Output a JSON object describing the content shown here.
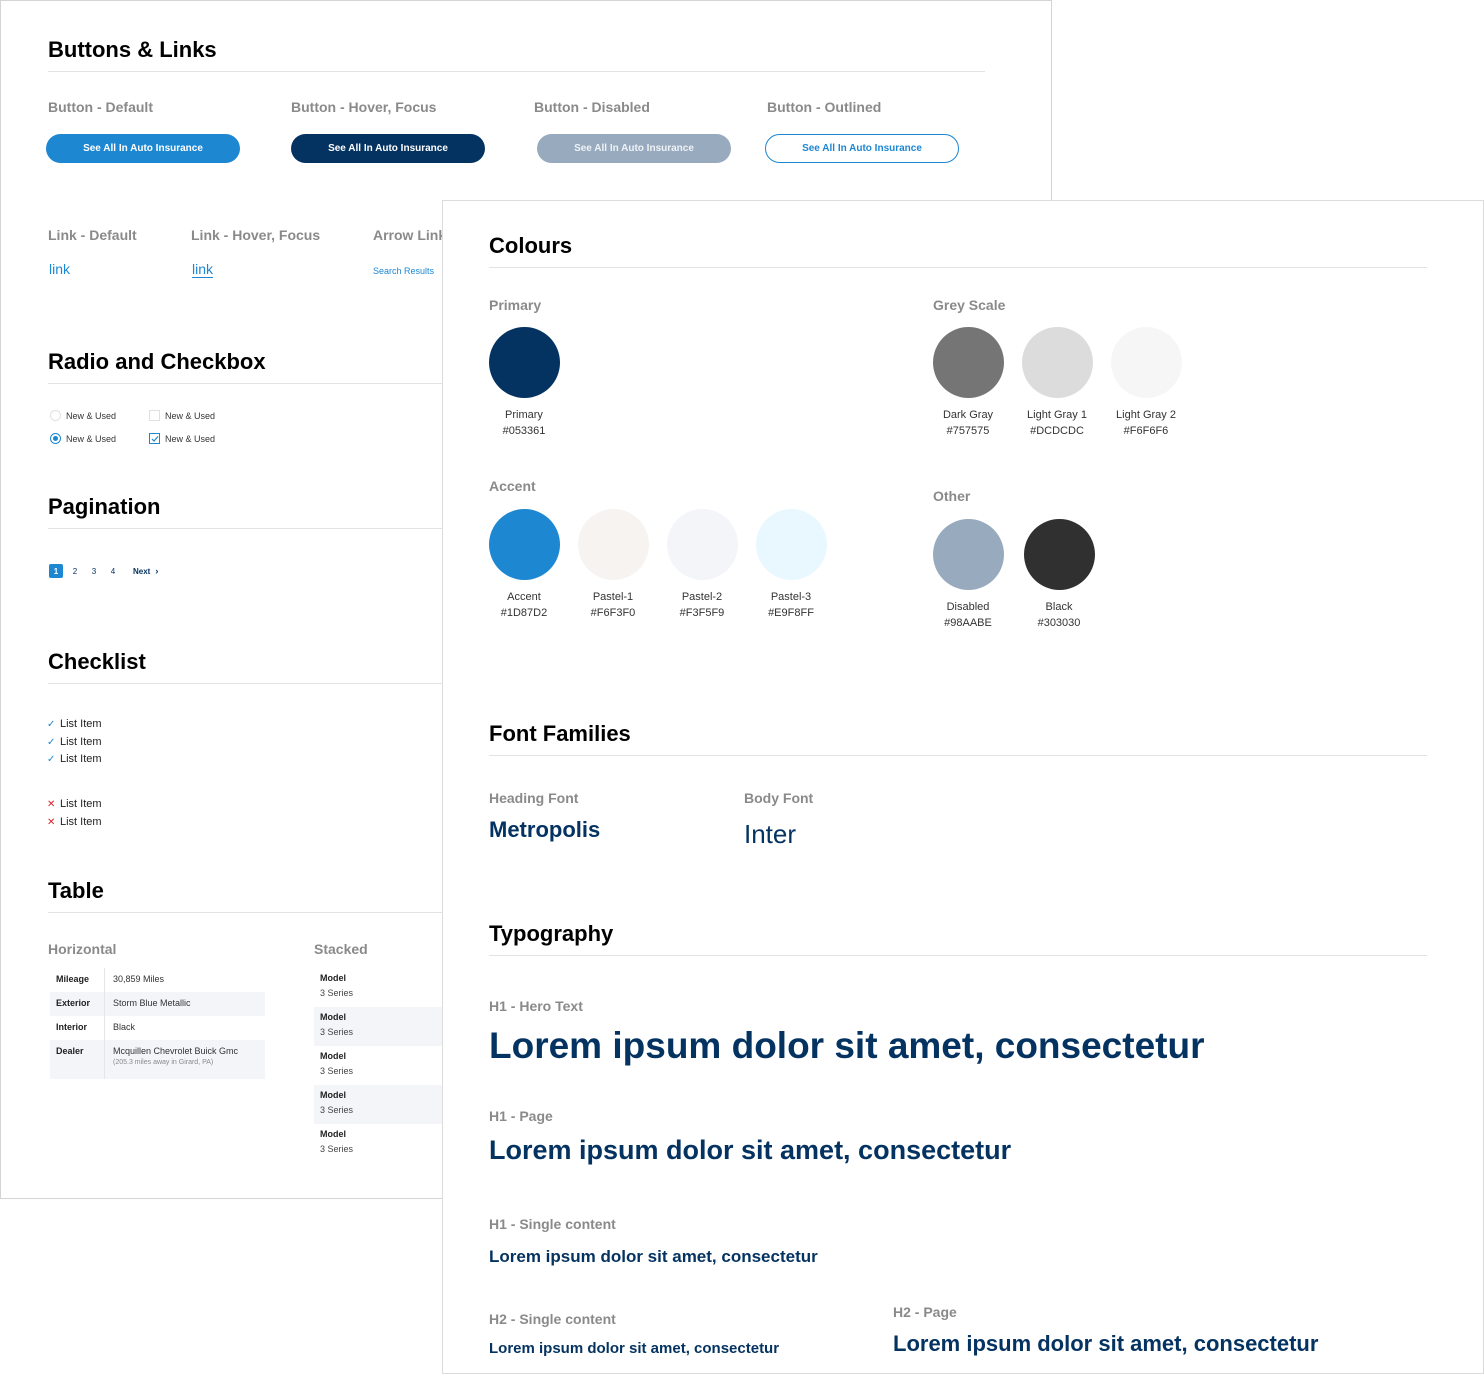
{
  "left_panel": {
    "buttons_links": {
      "title": "Buttons & Links",
      "buttons": [
        {
          "label": "Button - Default",
          "text": "See All In Auto Insurance"
        },
        {
          "label": "Button - Hover, Focus",
          "text": "See All In Auto Insurance"
        },
        {
          "label": "Button - Disabled",
          "text": "See All In Auto Insurance"
        },
        {
          "label": "Button - Outlined",
          "text": "See All In Auto Insurance"
        }
      ],
      "links": [
        {
          "label": "Link - Default",
          "text": "link"
        },
        {
          "label": "Link - Hover, Focus",
          "text": "link"
        },
        {
          "label": "Arrow Link",
          "text": "Search Results",
          "arrow_icon": "chevron-right-icon"
        }
      ]
    },
    "radio_checkbox": {
      "title": "Radio and Checkbox",
      "radios": [
        {
          "label": "New & Used",
          "checked": false
        },
        {
          "label": "New & Used",
          "checked": true
        }
      ],
      "checkboxes": [
        {
          "label": "New & Used",
          "checked": false
        },
        {
          "label": "New & Used",
          "checked": true
        }
      ]
    },
    "pagination": {
      "title": "Pagination",
      "pages": [
        "1",
        "2",
        "3",
        "4"
      ],
      "current_page": "1",
      "next_label": "Next",
      "next_icon": "›"
    },
    "checklist": {
      "title": "Checklist",
      "check_icon": "✓",
      "cross_icon": "✕",
      "positive": [
        "List Item",
        "List Item",
        "List Item"
      ],
      "negative": [
        "List Item",
        "List Item"
      ]
    },
    "table": {
      "title": "Table",
      "horizontal": {
        "label": "Horizontal",
        "rows": [
          {
            "key": "Mileage",
            "value": "30,859 Miles"
          },
          {
            "key": "Exterior",
            "value": "Storm Blue Metallic"
          },
          {
            "key": "Interior",
            "value": "Black"
          },
          {
            "key": "Dealer",
            "value": "Mcquillen Chevrolet Buick Gmc",
            "sub": "(205.3 miles away in Girard, PA)"
          }
        ]
      },
      "stacked": {
        "label": "Stacked",
        "rows": [
          {
            "key": "Model",
            "value": "3 Series"
          },
          {
            "key": "Model",
            "value": "3 Series"
          },
          {
            "key": "Model",
            "value": "3 Series"
          },
          {
            "key": "Model",
            "value": "3 Series"
          },
          {
            "key": "Model",
            "value": "3 Series"
          }
        ]
      }
    }
  },
  "right_panel": {
    "colours": {
      "title": "Colours",
      "primary": {
        "label": "Primary",
        "swatches": [
          {
            "name": "Primary",
            "hex": "#053361"
          }
        ]
      },
      "accent": {
        "label": "Accent",
        "swatches": [
          {
            "name": "Accent",
            "hex": "#1D87D2"
          },
          {
            "name": "Pastel-1",
            "hex": "#F6F3F0"
          },
          {
            "name": "Pastel-2",
            "hex": "#F3F5F9"
          },
          {
            "name": "Pastel-3",
            "hex": "#E9F8FF"
          }
        ]
      },
      "grey_scale": {
        "label": "Grey Scale",
        "swatches": [
          {
            "name": "Dark Gray",
            "hex": "#757575"
          },
          {
            "name": "Light Gray 1",
            "hex": "#DCDCDC"
          },
          {
            "name": "Light Gray 2",
            "hex": "#F6F6F6"
          }
        ]
      },
      "other": {
        "label": "Other",
        "swatches": [
          {
            "name": "Disabled",
            "hex": "#98AABE"
          },
          {
            "name": "Black",
            "hex": "#303030"
          }
        ]
      }
    },
    "font_families": {
      "title": "Font Families",
      "heading": {
        "label": "Heading Font",
        "sample": "Metropolis"
      },
      "body": {
        "label": "Body Font",
        "sample": "Inter"
      }
    },
    "typography": {
      "title": "Typography",
      "styles": [
        {
          "label": "H1 - Hero Text",
          "sample": "Lorem ipsum dolor sit amet, consectetur"
        },
        {
          "label": "H1 - Page",
          "sample": "Lorem ipsum dolor sit amet, consectetur"
        },
        {
          "label": "H1 - Single content",
          "sample": "Lorem ipsum dolor sit amet, consectetur"
        },
        {
          "label": "H2 -  Single content",
          "sample": "Lorem ipsum dolor sit amet, consectetur"
        },
        {
          "label": "H2 - Page",
          "sample": "Lorem ipsum dolor sit amet, consectetur"
        }
      ]
    }
  }
}
